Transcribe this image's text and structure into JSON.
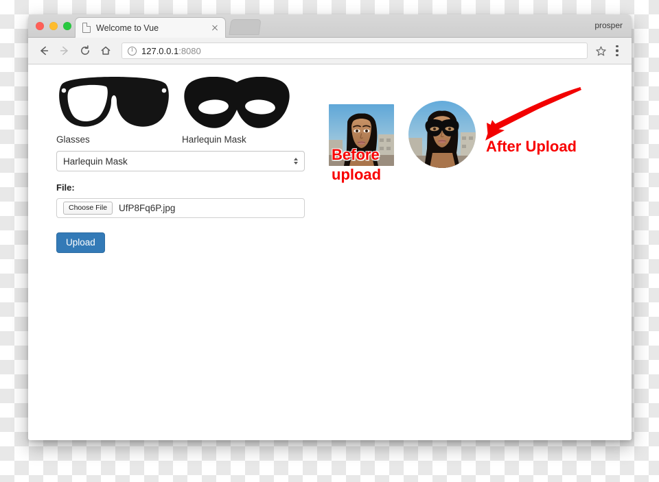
{
  "window": {
    "traffic_lights": [
      "close",
      "minimize",
      "zoom"
    ],
    "profile_name": "prosper"
  },
  "tabs": [
    {
      "title": "Welcome to Vue",
      "active": true,
      "close_label": "×"
    },
    {
      "title": "",
      "active": false
    }
  ],
  "toolbar": {
    "back_label": "Back",
    "forward_label": "Forward",
    "reload_label": "Reload",
    "home_label": "Home",
    "bookmark_label": "Bookmark this page",
    "menu_label": "Customize and control Google Chrome",
    "url_host": "127.0.0.1",
    "url_port": ":8080",
    "security_label": "Site information"
  },
  "page": {
    "mask_options": [
      {
        "label": "Glasses",
        "art": "glasses"
      },
      {
        "label": "Harlequin Mask",
        "art": "harlequin-mask"
      }
    ],
    "select": {
      "value": "Harlequin Mask",
      "options": [
        "Glasses",
        "Harlequin Mask"
      ]
    },
    "file_field": {
      "label": "File:",
      "button_label": "Choose File",
      "file_name": "UfP8Fq6P.jpg"
    },
    "upload_button": "Upload"
  },
  "annotations": {
    "before": "Before\nupload",
    "after": "After Upload",
    "arrow": "arrow pointing to after-upload avatar",
    "color": "#f80000"
  },
  "photos": {
    "before_alt": "Portrait photo before upload",
    "after_alt": "Circular avatar with harlequin mask after upload"
  }
}
